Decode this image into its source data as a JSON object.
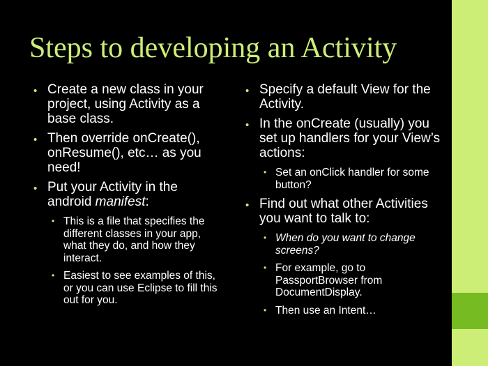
{
  "slide": {
    "title": "Steps to developing an Activity",
    "accent_color": "#ccee77",
    "accent_dark": "#77bb22",
    "left_column": {
      "b1": "Create a new class in your project, using Activity as a base class.",
      "b2": "Then override onCreate(), onResume(), etc… as you need!",
      "b3_prefix": "Put your Activity in the android ",
      "b3_em": "manifest",
      "b3_suffix": ":",
      "b3_sub1": "This is a file that specifies the different classes in your app, what they do, and how they interact.",
      "b3_sub2": "Easiest to see examples of this, or you can use Eclipse to fill this out for you."
    },
    "right_column": {
      "b1": "Specify a default View for the Activity.",
      "b2": "In the onCreate (usually) you set up handlers for your View’s actions:",
      "b2_sub1": "Set an onClick handler for some button?",
      "b3": "Find out what other Activities you want to talk to:",
      "b3_sub1": "When do you want to change screens?",
      "b3_sub2": "For example, go to PassportBrowser from DocumentDisplay.",
      "b3_sub3": "Then use an Intent…"
    }
  }
}
